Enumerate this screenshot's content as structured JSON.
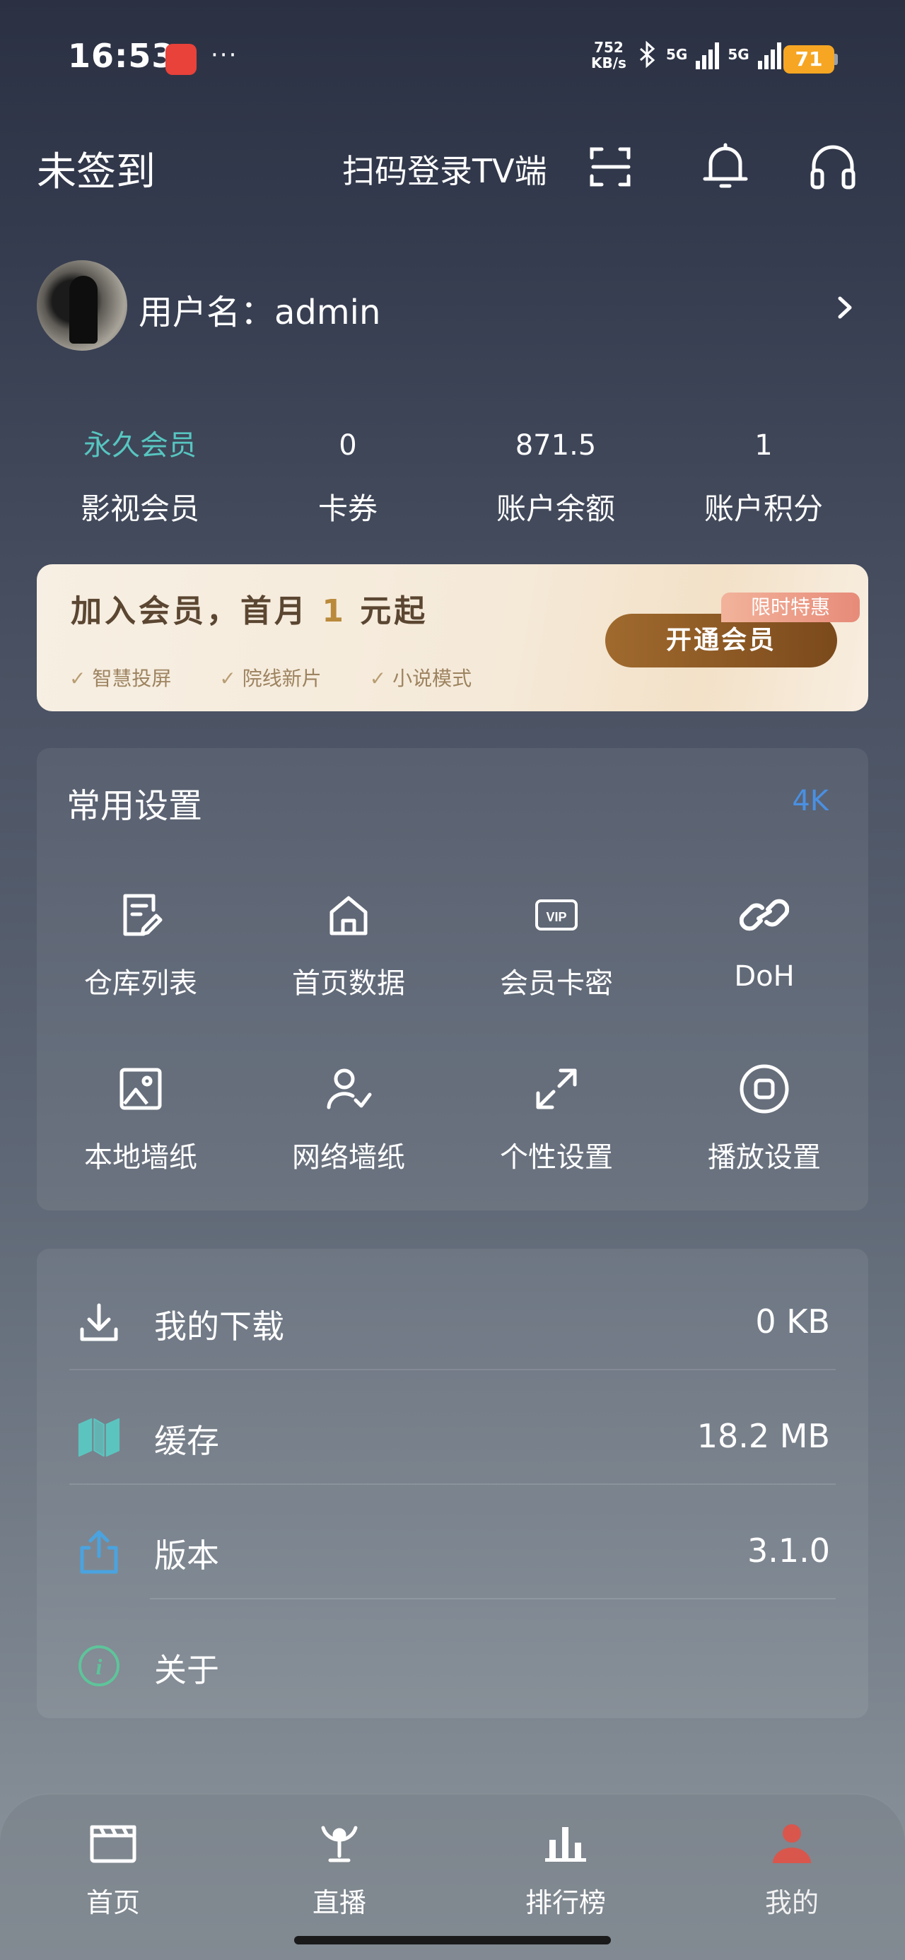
{
  "status_bar": {
    "time": "16:53",
    "dots": "···",
    "net_speed_value": "752",
    "net_speed_unit": "KB/s",
    "net1": "5G",
    "net2": "5G",
    "battery": "71",
    "battery_color": "#f6a623"
  },
  "header": {
    "sign_status": "未签到",
    "tv_login": "扫码登录TV端",
    "icons": [
      "scan-icon",
      "bell-icon",
      "headset-icon"
    ]
  },
  "profile": {
    "username_label": "用户名：admin"
  },
  "stats": [
    {
      "value": "永久会员",
      "label": "影视会员"
    },
    {
      "value": "0",
      "label": "卡券"
    },
    {
      "value": "871.5",
      "label": "账户余额"
    },
    {
      "value": "1",
      "label": "账户积分"
    }
  ],
  "banner": {
    "title_prefix": "加入会员，首月",
    "title_num": "1",
    "title_suffix": "元起",
    "features": [
      "智慧投屏",
      "院线新片",
      "小说模式"
    ],
    "tag": "限时特惠",
    "button": "开通会员"
  },
  "settings": {
    "title": "常用设置",
    "badge": "4K",
    "items": [
      {
        "label": "仓库列表",
        "icon": "note-edit-icon"
      },
      {
        "label": "首页数据",
        "icon": "home-icon"
      },
      {
        "label": "会员卡密",
        "icon": "vip-card-icon"
      },
      {
        "label": "DoH",
        "icon": "link-icon"
      },
      {
        "label": "本地墙纸",
        "icon": "image-icon"
      },
      {
        "label": "网络墙纸",
        "icon": "user-check-icon"
      },
      {
        "label": "个性设置",
        "icon": "expand-icon"
      },
      {
        "label": "播放设置",
        "icon": "stop-circle-icon"
      }
    ]
  },
  "list": [
    {
      "label": "我的下载",
      "value": "0 KB",
      "icon": "download-icon"
    },
    {
      "label": "缓存",
      "value": "18.2 MB",
      "icon": "map-icon"
    },
    {
      "label": "版本",
      "value": "3.1.0",
      "icon": "share-icon"
    },
    {
      "label": "关于",
      "value": "",
      "icon": "info-icon"
    }
  ],
  "bottom_nav": [
    {
      "label": "首页",
      "icon": "clapperboard-icon"
    },
    {
      "label": "直播",
      "icon": "live-icon"
    },
    {
      "label": "排行榜",
      "icon": "bar-chart-icon"
    },
    {
      "label": "我的",
      "icon": "user-icon"
    }
  ],
  "colors": {
    "teal": "#57c5c0",
    "accent_blue": "#4a90e2",
    "nav_active": "#d9564c"
  }
}
